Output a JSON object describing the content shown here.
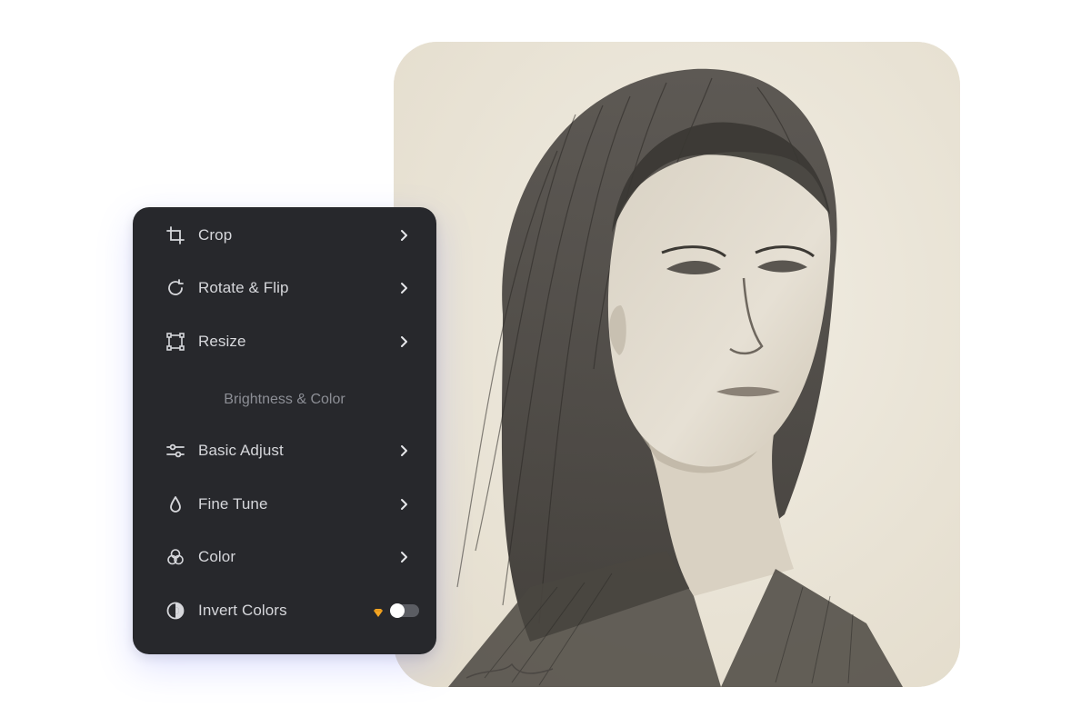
{
  "menu": {
    "crop_label": "Crop",
    "rotate_label": "Rotate & Flip",
    "resize_label": "Resize",
    "section_title": "Brightness & Color",
    "basic_adjust_label": "Basic Adjust",
    "fine_tune_label": "Fine Tune",
    "color_label": "Color",
    "invert_label": "Invert Colors",
    "invert_enabled": false
  },
  "icons": {
    "crop": "crop-icon",
    "rotate": "rotate-icon",
    "resize": "resize-icon",
    "basic_adjust": "sliders-icon",
    "fine_tune": "droplet-icon",
    "color": "color-circles-icon",
    "invert": "invert-icon",
    "chevron": "chevron-right-icon",
    "premium": "premium-diamond-icon"
  },
  "colors": {
    "panel_bg": "#27282c",
    "text": "#d6d7db",
    "muted": "#8c8e95",
    "premium": "#f5a623",
    "toggle_off": "#5b5d63"
  }
}
